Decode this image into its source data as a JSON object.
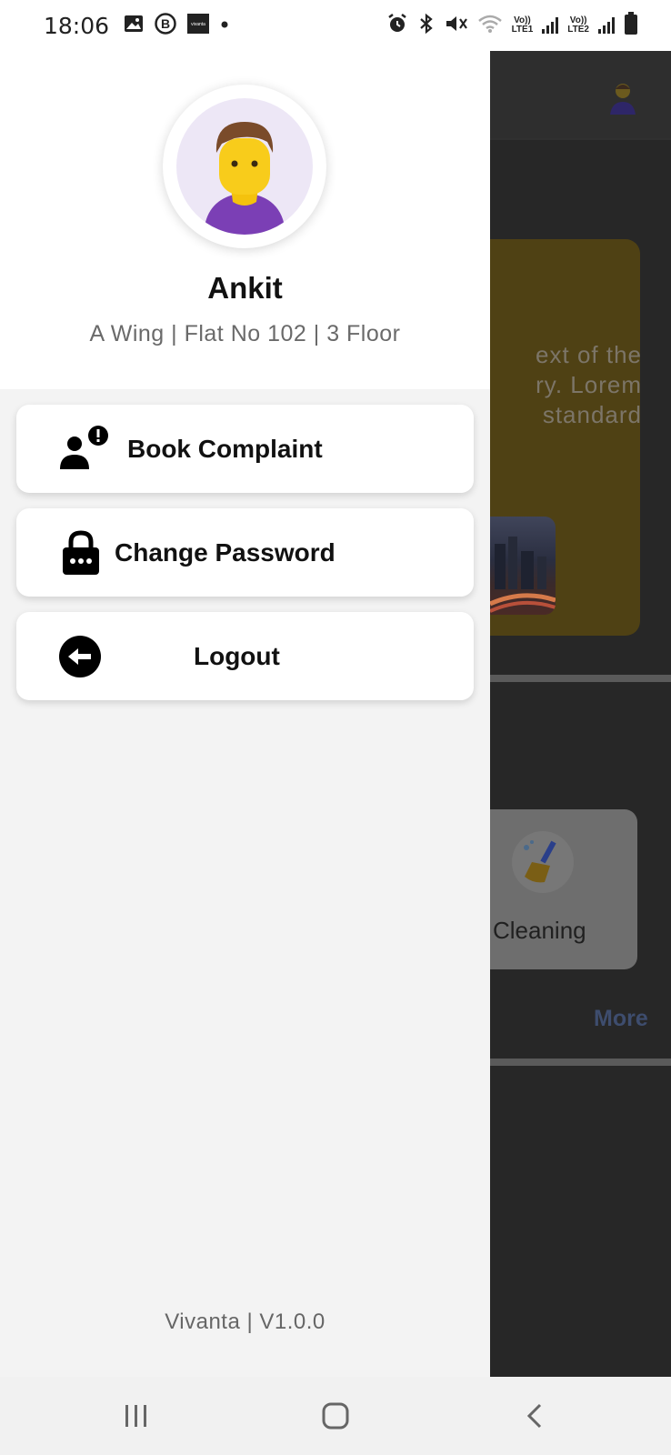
{
  "status_bar": {
    "time": "18:06",
    "notification_icons": [
      "image-icon",
      "b-badge-icon",
      "app-icon",
      "dot-icon"
    ],
    "app_icon_text": "vivanta",
    "system_icons": [
      "alarm-icon",
      "bluetooth-icon",
      "mute-icon",
      "wifi-icon",
      "signal-lte1-icon",
      "signal-lte2-icon",
      "battery-icon"
    ],
    "lte1_top": "Vo))",
    "lte1_bottom": "LTE1",
    "lte2_top": "Vo))",
    "lte2_bottom": "LTE2"
  },
  "drawer": {
    "user": {
      "name": "Ankit",
      "address": "A Wing | Flat No 102 | 3 Floor"
    },
    "menu": [
      {
        "label": "Book Complaint",
        "icon": "user-alert-icon"
      },
      {
        "label": "Change Password",
        "icon": "lock-icon"
      },
      {
        "label": "Logout",
        "icon": "logout-arrow-icon"
      }
    ],
    "version": "Vivanta | V1.0.0"
  },
  "background_screen": {
    "card_text_lines": [
      "ext of the",
      "ry. Lorem",
      "standard"
    ],
    "service_label": "Cleaning",
    "more_link": "More"
  },
  "nav_bar": {
    "buttons": [
      "recents-icon",
      "home-icon",
      "back-icon"
    ]
  },
  "colors": {
    "drawer_bg": "#f3f3f3",
    "header_bg": "#ffffff",
    "overlay_bg": "#272727",
    "promo_card": "#4f4114",
    "avatar_bg": "#ede7f6"
  }
}
